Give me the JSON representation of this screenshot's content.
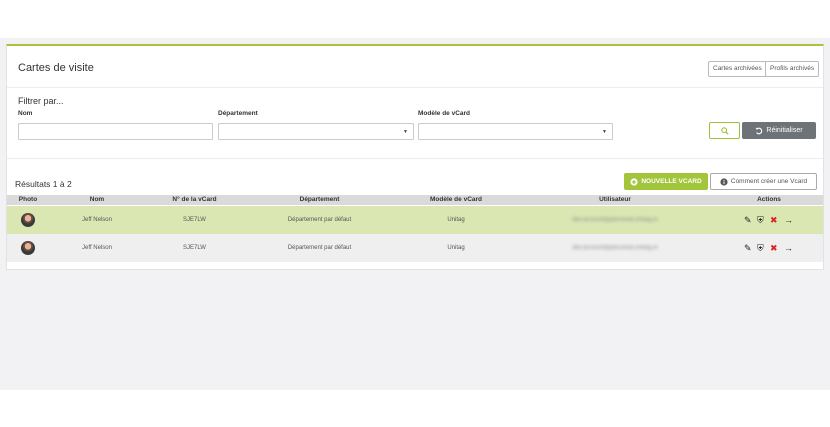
{
  "page": {
    "title": "Cartes de visite",
    "header_buttons": [
      "Cartes archivées",
      "Profils archivés"
    ]
  },
  "filter": {
    "title": "Filtrer par...",
    "labels": {
      "nom": "Nom",
      "departement": "Département",
      "modele": "Modèle de vCard"
    },
    "values": {
      "nom": "",
      "departement": "",
      "modele": ""
    },
    "search_icon": "search-icon",
    "reset_label": "Réinitialiser"
  },
  "results": {
    "summary": "Résultats 1 à 2",
    "new_button": "NOUVELLE VCARD",
    "help_button": "Comment créer une Vcard"
  },
  "table": {
    "headers": [
      "Photo",
      "Nom",
      "N° de la vCard",
      "Département",
      "Modèle de vCard",
      "Utilisateur",
      "Actions"
    ],
    "rows": [
      {
        "nom": "Jeff Nelson",
        "numero": "SJE7LW",
        "departement": "Département par défaut",
        "modele": "Unitag",
        "utilisateur": "dev.account@personal.unitag.io"
      },
      {
        "nom": "Jeff Nelson",
        "numero": "SJE7LW",
        "departement": "Département par défaut",
        "modele": "Unitag",
        "utilisateur": "dev.account@personal.unitag.io"
      }
    ],
    "action_icons": [
      "edit-icon",
      "shield-icon",
      "user-remove-icon",
      "arrow-right-icon"
    ]
  },
  "colors": {
    "accent": "#a3c53b",
    "highlight_row": "#dbe7b3",
    "reset_button": "#6e7378"
  }
}
